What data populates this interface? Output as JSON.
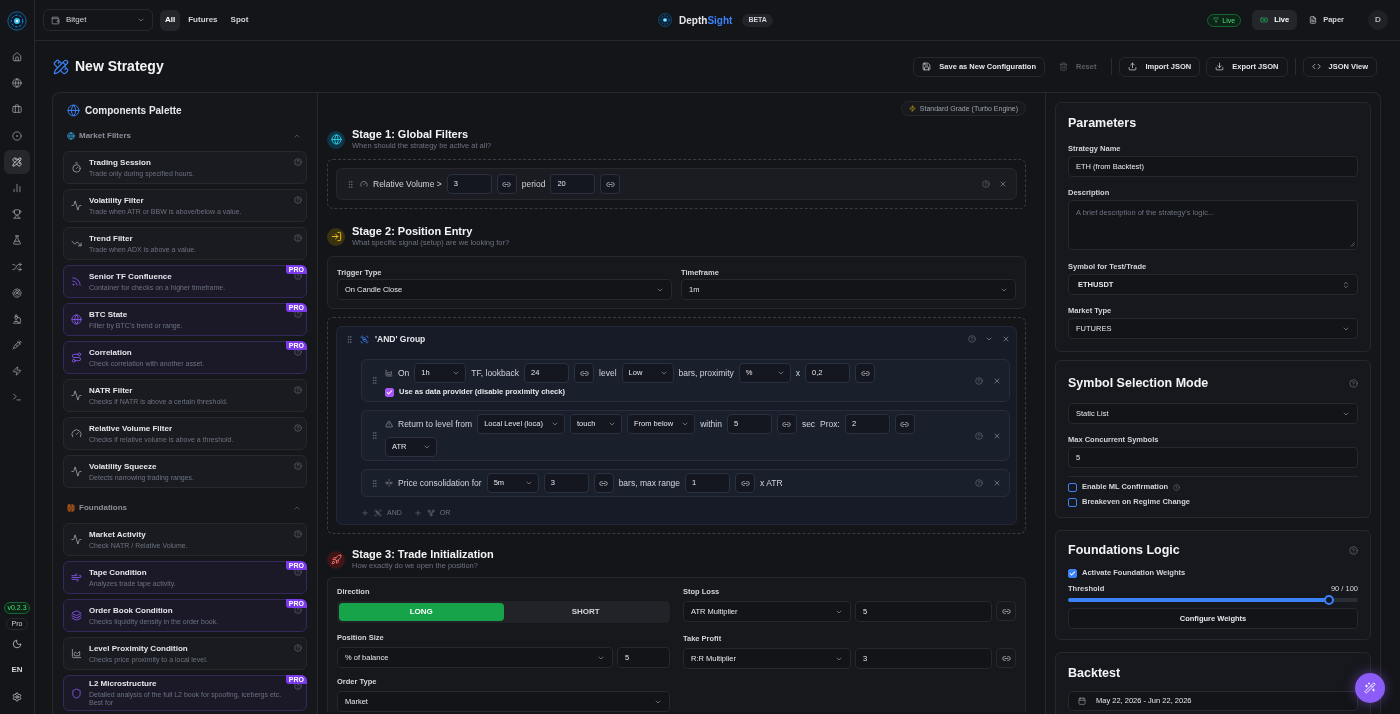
{
  "app": {
    "brand": "Depth",
    "brand_accent": "Sight",
    "badge": "BETA",
    "version": "v0.2.3",
    "plan": "Pro",
    "language": "EN"
  },
  "nav_items": [
    {
      "selected": false
    },
    {
      "selected": false
    },
    {
      "selected": false
    },
    {
      "selected": false
    },
    {
      "selected": true
    },
    {
      "selected": false
    },
    {
      "selected": false
    },
    {
      "selected": false
    },
    {
      "selected": false
    },
    {
      "selected": false
    },
    {
      "selected": false
    },
    {
      "selected": false
    },
    {
      "selected": false
    },
    {
      "selected": false
    }
  ],
  "top_bar": {
    "exchange": "Bitget",
    "market_tabs": [
      {
        "label": "All",
        "selected": true
      },
      {
        "label": "Futures",
        "selected": false
      },
      {
        "label": "Spot",
        "selected": false
      }
    ],
    "status": "Live",
    "mode_tabs": [
      {
        "label": "Live",
        "selected": true
      },
      {
        "label": "Paper",
        "selected": false
      }
    ],
    "avatar": "D"
  },
  "page": {
    "title": "New Strategy",
    "toolbar": [
      {
        "label": "Save as New Configuration",
        "disabled": false,
        "divider_before": false
      },
      {
        "label": "Reset",
        "disabled": true,
        "divider_before": false
      },
      {
        "label": "Import JSON",
        "disabled": false,
        "divider_before": true
      },
      {
        "label": "Export JSON",
        "disabled": false,
        "divider_before": false
      },
      {
        "label": "JSON View",
        "disabled": false,
        "divider_before": true
      }
    ]
  },
  "palette": {
    "title": "Components Palette",
    "sections": [
      {
        "title": "Market Filters",
        "expanded": true,
        "items": [
          {
            "title": "Trading Session",
            "description": "Trade only during specified hours."
          },
          {
            "title": "Volatility Filter",
            "description": "Trade when ATR or BBW is above/below a value."
          },
          {
            "title": "Trend Filter",
            "description": "Trade when ADX is above a value."
          },
          {
            "title": "Senior TF Confluence",
            "description": "Container for checks on a higher timeframe.",
            "badge": "PRO"
          },
          {
            "title": "BTC State",
            "description": "Filter by BTC's trend or range.",
            "badge": "PRO"
          },
          {
            "title": "Correlation",
            "description": "Check correlation with another asset.",
            "badge": "PRO"
          },
          {
            "title": "NATR Filter",
            "description": "Checks if NATR is above a certain threshold."
          },
          {
            "title": "Relative Volume Filter",
            "description": "Checks if relative volume is above a threshold."
          },
          {
            "title": "Volatility Squeeze",
            "description": "Detects narrowing trading ranges."
          }
        ]
      },
      {
        "title": "Foundations",
        "expanded": true,
        "items": [
          {
            "title": "Market Activity",
            "description": "Check NATR / Relative Volume."
          },
          {
            "title": "Tape Condition",
            "description": "Analyzes trade tape activity.",
            "badge": "PRO"
          },
          {
            "title": "Order Book Condition",
            "description": "Checks liquidity density in the order book.",
            "badge": "PRO"
          },
          {
            "title": "Level Proximity Condition",
            "description": "Checks price proximity to a local level."
          },
          {
            "title": "L2 Microstructure",
            "description": "Detailed analysis of the full L2 book for spoofing, icebergs etc. Best for",
            "badge": "PRO"
          }
        ]
      }
    ]
  },
  "builder": {
    "engine_badge": "Standard Grade (Turbo Engine)",
    "stage_1": {
      "title": "Stage 1: Global Filters",
      "subtitle": "When should the strategy be active at all?",
      "filters": [
        {
          "tokens": [
            {
              "kind": "text",
              "text": "Relative Volume >"
            },
            {
              "kind": "input",
              "value": "3"
            },
            {
              "kind": "link"
            },
            {
              "kind": "text",
              "text": "period"
            },
            {
              "kind": "input",
              "value": "20"
            },
            {
              "kind": "link"
            }
          ]
        }
      ]
    },
    "stage_2": {
      "title": "Stage 2: Position Entry",
      "subtitle": "What specific signal (setup) are we looking for?",
      "trigger_type": {
        "label": "Trigger Type",
        "value": "On Candle Close"
      },
      "timeframe": {
        "label": "Timeframe",
        "value": "1m"
      },
      "group": {
        "title": "'AND' Group",
        "expanded": true,
        "conditions": [
          {
            "lines": [
              [
                {
                  "kind": "text",
                  "text": "On"
                },
                {
                  "kind": "select",
                  "value": "1h"
                },
                {
                  "kind": "text",
                  "text": "TF, lookback"
                },
                {
                  "kind": "input",
                  "value": "24"
                },
                {
                  "kind": "link"
                },
                {
                  "kind": "text",
                  "text": "level"
                },
                {
                  "kind": "select",
                  "value": "Low"
                },
                {
                  "kind": "text",
                  "text": "bars, proximity"
                },
                {
                  "kind": "select",
                  "value": "%"
                },
                {
                  "kind": "text",
                  "text": "x"
                },
                {
                  "kind": "input",
                  "value": "0,2"
                },
                {
                  "kind": "link"
                }
              ],
              [
                {
                  "kind": "checkbox",
                  "label": "Use as data provider (disable proximity check)",
                  "checked": true
                }
              ]
            ]
          },
          {
            "lines": [
              [
                {
                  "kind": "text",
                  "text": "Return to level from"
                },
                {
                  "kind": "select",
                  "value": "Local Level (loca)"
                },
                {
                  "kind": "select",
                  "value": "touch"
                },
                {
                  "kind": "select",
                  "value": "From below"
                },
                {
                  "kind": "text",
                  "text": "within"
                },
                {
                  "kind": "input",
                  "value": "5"
                },
                {
                  "kind": "link"
                },
                {
                  "kind": "text",
                  "text": "sec"
                },
                {
                  "kind": "text",
                  "text": "Prox:"
                },
                {
                  "kind": "input",
                  "value": "2"
                },
                {
                  "kind": "link"
                }
              ],
              [
                {
                  "kind": "select",
                  "value": "ATR"
                }
              ]
            ]
          },
          {
            "lines": [
              [
                {
                  "kind": "text",
                  "text": "Price consolidation for"
                },
                {
                  "kind": "select",
                  "value": "5m"
                },
                {
                  "kind": "input",
                  "value": "3"
                },
                {
                  "kind": "link"
                },
                {
                  "kind": "text",
                  "text": "bars, max range"
                },
                {
                  "kind": "input",
                  "value": "1"
                },
                {
                  "kind": "link"
                },
                {
                  "kind": "text",
                  "text": "x ATR"
                }
              ]
            ]
          }
        ],
        "add_buttons": [
          {
            "label": "AND"
          },
          {
            "label": "OR"
          }
        ]
      }
    },
    "stage_3": {
      "title": "Stage 3: Trade Initialization",
      "subtitle": "How exactly do we open the position?",
      "direction": {
        "label": "Direction",
        "options": [
          {
            "label": "LONG",
            "selected": true
          },
          {
            "label": "SHORT",
            "selected": false
          }
        ]
      },
      "position_size": {
        "label": "Position Size",
        "mode": "% of balance",
        "value": "5"
      },
      "order_type": {
        "label": "Order Type",
        "value": "Market"
      },
      "stop_loss": {
        "label": "Stop Loss",
        "mode": "ATR Multiplier",
        "value": "5"
      },
      "take_profit": {
        "label": "Take Profit",
        "mode": "R:R Multiplier",
        "value": "3"
      }
    }
  },
  "parameters": {
    "title": "Parameters",
    "strategy_name": {
      "label": "Strategy Name",
      "value": "ETH (from Backtest)"
    },
    "description": {
      "label": "Description",
      "placeholder": "A brief description of the strategy's logic..."
    },
    "symbol": {
      "label": "Symbol for Test/Trade",
      "value": "ETHUSDT"
    },
    "market_type": {
      "label": "Market Type",
      "value": "FUTURES"
    }
  },
  "symbol_selection": {
    "title": "Symbol Selection Mode",
    "mode": "Static List",
    "max_concurrent": {
      "label": "Max Concurrent Symbols",
      "value": "5"
    },
    "options": [
      {
        "label": "Enable ML Confirmation",
        "checked": false,
        "help": true
      },
      {
        "label": "Breakeven on Regime Change",
        "checked": false,
        "help": false
      }
    ]
  },
  "foundations_logic": {
    "title": "Foundations Logic",
    "weights": {
      "label": "Activate Foundation Weights",
      "checked": true
    },
    "threshold": {
      "label": "Threshold",
      "reading": "90 / 100",
      "level": 0.9
    },
    "button": "Configure Weights"
  },
  "backtest": {
    "title": "Backtest",
    "date_range": "May 22, 2026 - Jun 22, 2026"
  }
}
